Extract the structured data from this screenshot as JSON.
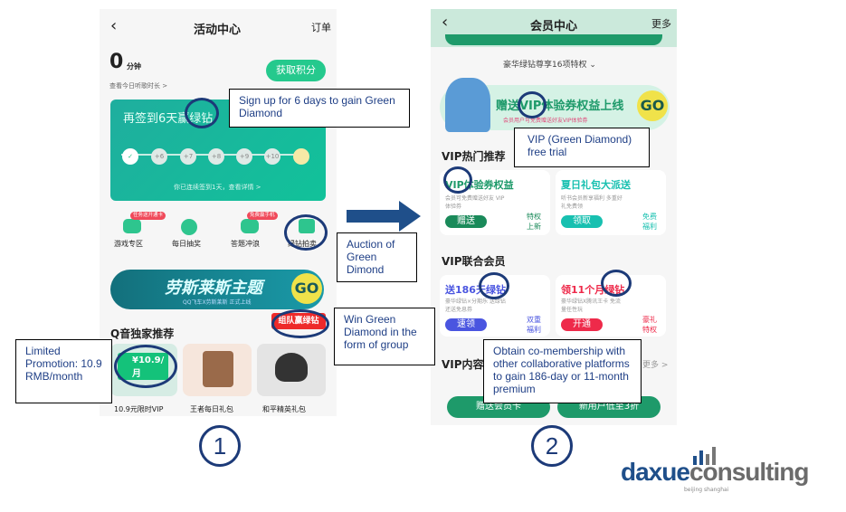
{
  "screen1": {
    "title": "活动中心",
    "right_link": "订单",
    "minutes": "0",
    "minutes_unit": "分钟",
    "listen_link": "查看今日听歌时长 >",
    "points_button": "获取积分",
    "signin": {
      "headline": "再签到6天赢绿钻",
      "days": [
        "1天",
        "2天",
        "3天",
        "4天",
        "5天",
        "6天",
        "7天"
      ],
      "rewards": [
        "✓",
        "+6",
        "+7",
        "+8",
        "+9",
        "+10",
        ""
      ],
      "status": "你已连续签到1天，查看详情 >"
    },
    "shortcuts": [
      {
        "label": "游戏专区",
        "badge": "任务送开通卡"
      },
      {
        "label": "每日抽奖",
        "badge": ""
      },
      {
        "label": "答题冲浪",
        "badge": "免费赢手机"
      },
      {
        "label": "绿钻拍卖",
        "badge": ""
      }
    ],
    "banner": {
      "title": "劳斯莱斯主题",
      "subtitle": "QQ飞车X劳斯莱斯 正式上线",
      "go": "GO"
    },
    "group_tag": "组队赢绿钻",
    "section_title": "Q音独家推荐",
    "products": [
      {
        "label": "10.9元限时VIP",
        "price": "¥10.9/月"
      },
      {
        "label": "王者每日礼包"
      },
      {
        "label": "和平精英礼包"
      }
    ]
  },
  "screen2": {
    "title": "会员中心",
    "right_link": "更多",
    "privileges": "豪华绿钻尊享16项特权 ⌄",
    "banner": {
      "title": "赠送VIP体验券权益上线",
      "subtitle": "会员用户可免费赠送好友VIP体验券",
      "go": "GO"
    },
    "hot_title": "VIP热门推荐",
    "hot_cards": [
      {
        "title": "VIP体验券权益",
        "desc": "会员可免费赠送好友 VIP体验券",
        "button": "赠送",
        "tag": "特权 上新",
        "color": "#1a8a5a"
      },
      {
        "title": "夏日礼包大派送",
        "desc": "听书会员新享福利 多重好礼免费领",
        "button": "领取",
        "tag": "免费 福利",
        "color": "#18c0b0"
      }
    ],
    "joint_title": "VIP联合会员",
    "joint_cards": [
      {
        "title": "送186天绿钻",
        "desc": "豪华绿钻×分期乐 送绿钻还送免息券",
        "button": "速领",
        "tag": "双重 福利",
        "color": "#4a55e0"
      },
      {
        "title": "领11个月绿钻",
        "desc": "豪华绿钻X腾讯王卡 免流量任性玩",
        "button": "开通",
        "tag": "豪礼 特权",
        "color": "#ee2a4a"
      }
    ],
    "content_title": "VIP内容",
    "content_more": "更多 >",
    "bottom_buttons": [
      "赠送会员卡",
      "新用户低至3折"
    ]
  },
  "annotations": {
    "signup": "Sign up for 6 days to gain Green Diamond",
    "trial": "VIP (Green Diamond) free trial",
    "auction": "Auction of Green Dimond",
    "group": "Win Green Diamond in the form of group",
    "promo": "Limited Promotion: 10.9 RMB/month",
    "comember": "Obtain co-membership with other collaborative platforms to gain 186-day or 11-month premium"
  },
  "step_numbers": [
    "1",
    "2"
  ],
  "logo": {
    "part1": "daxue",
    "part2": "consulting",
    "tagline": "beijing shanghai"
  },
  "colors": {
    "green": "#1dbf84",
    "navy": "#1c3a78",
    "teal": "#12b59a"
  }
}
